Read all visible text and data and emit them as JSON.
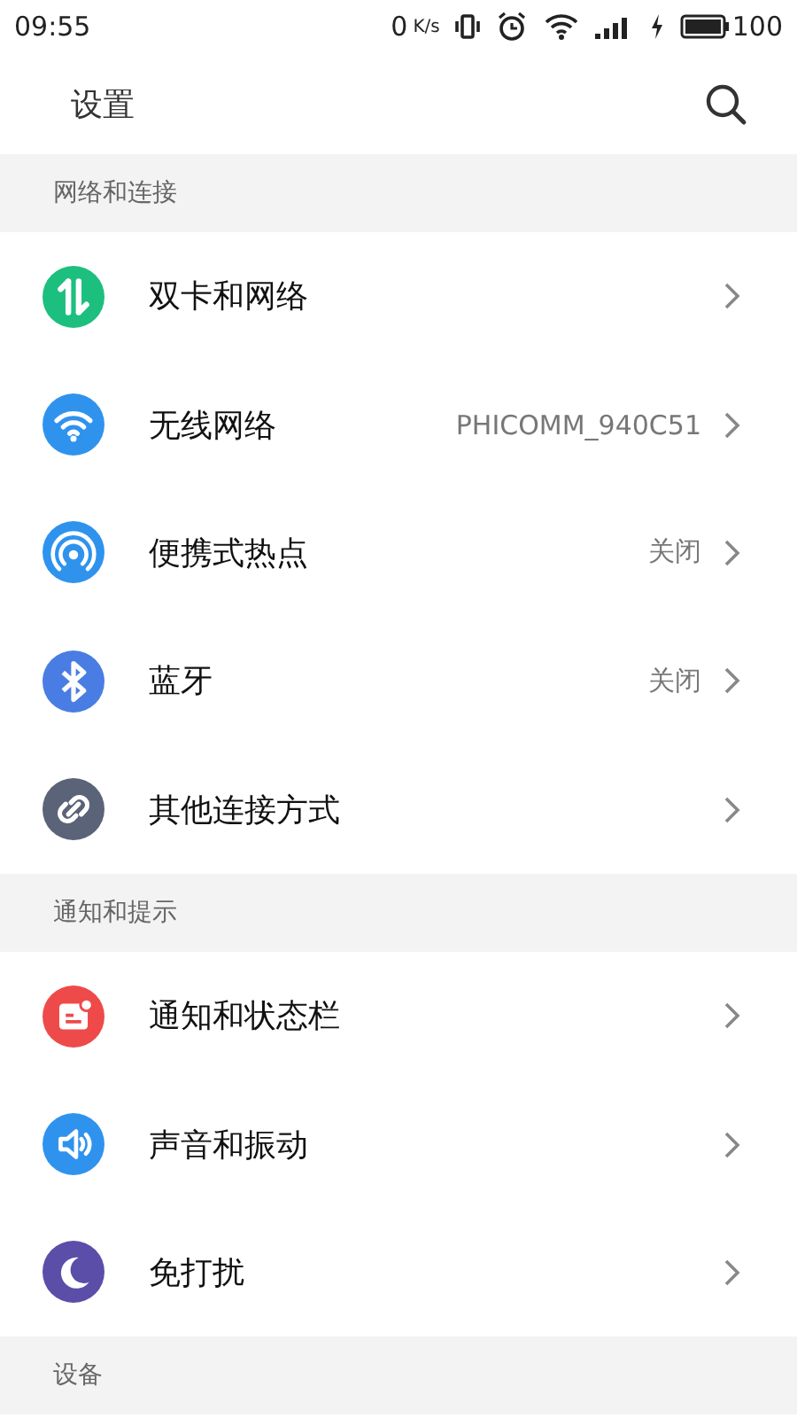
{
  "status_bar": {
    "time": "09:55",
    "speed": "0",
    "speed_unit": "K/s",
    "battery": "100"
  },
  "header": {
    "title": "设置"
  },
  "sections": [
    {
      "title": "网络和连接",
      "items": [
        {
          "label": "双卡和网络",
          "kind": "sim",
          "color": "#1dbf7e"
        },
        {
          "label": "无线网络",
          "kind": "wifi",
          "color": "#2f93ee",
          "value": "PHICOMM_940C51"
        },
        {
          "label": "便携式热点",
          "kind": "hotspot",
          "color": "#2f93ee",
          "value": "关闭"
        },
        {
          "label": "蓝牙",
          "kind": "bluetooth",
          "color": "#4a7de3",
          "value": "关闭"
        },
        {
          "label": "其他连接方式",
          "kind": "link",
          "color": "#5a6378"
        }
      ]
    },
    {
      "title": "通知和提示",
      "items": [
        {
          "label": "通知和状态栏",
          "kind": "notification",
          "color": "#ee4a4a"
        },
        {
          "label": "声音和振动",
          "kind": "sound",
          "color": "#2f93ee"
        },
        {
          "label": "免打扰",
          "kind": "moon",
          "color": "#5b4ea8"
        }
      ]
    },
    {
      "title": "设备"
    }
  ]
}
